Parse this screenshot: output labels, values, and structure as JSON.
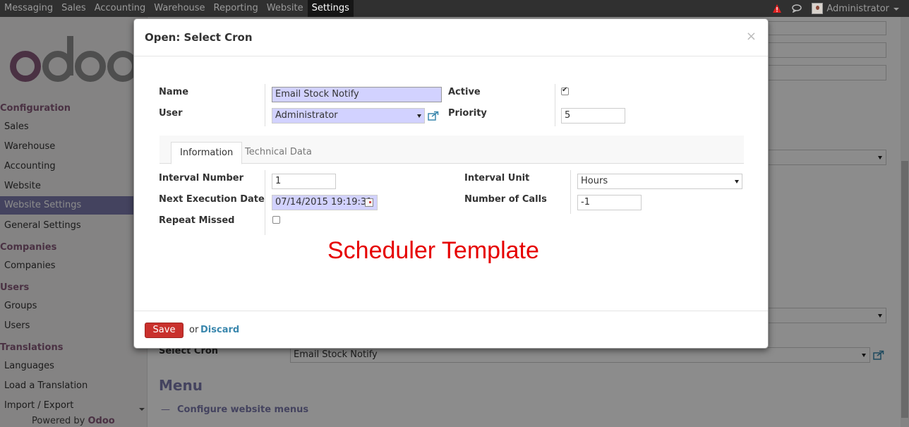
{
  "topbar": {
    "menu": [
      "Messaging",
      "Sales",
      "Accounting",
      "Warehouse",
      "Reporting",
      "Website",
      "Settings"
    ],
    "active": "Settings",
    "user": "Administrator"
  },
  "sidebar": {
    "sections": [
      {
        "title": "Configuration",
        "items": [
          "Sales",
          "Warehouse",
          "Accounting",
          "Website",
          "Website Settings",
          "General Settings"
        ]
      },
      {
        "title": "Companies",
        "items": [
          "Companies"
        ]
      },
      {
        "title": "Users",
        "items": [
          "Groups",
          "Users"
        ]
      },
      {
        "title": "Translations",
        "items": [
          "Languages",
          "Load a Translation",
          "Import / Export"
        ]
      }
    ],
    "active_item": "Website Settings",
    "powered_prefix": "Powered by",
    "powered_brand": "Odoo"
  },
  "background": {
    "select_cron_label": "Select Cron",
    "select_cron_value": "Email Stock Notify",
    "menu_heading": "Menu",
    "menu_link": "Configure website menus",
    "menu_dash": "—"
  },
  "modal": {
    "title": "Open: Select Cron",
    "close": "×",
    "name_label": "Name",
    "name_value": "Email Stock Notify",
    "user_label": "User",
    "user_value": "Administrator",
    "active_label": "Active",
    "active_checked": true,
    "priority_label": "Priority",
    "priority_value": "5",
    "tabs": [
      "Information",
      "Technical Data"
    ],
    "interval_number_label": "Interval Number",
    "interval_number_value": "1",
    "next_exec_label": "Next Execution Date",
    "next_exec_value": "07/14/2015 19:19:31",
    "repeat_missed_label": "Repeat Missed",
    "interval_unit_label": "Interval Unit",
    "interval_unit_value": "Hours",
    "number_calls_label": "Number of Calls",
    "number_calls_value": "-1",
    "annotation": "Scheduler Template",
    "save_label": "Save",
    "or_text": "or",
    "discard_label": "Discard"
  },
  "colors": {
    "accent": "#875a7b",
    "menu_purple": "#7c7bad",
    "save_red": "#c9302c",
    "annotation_red": "#e60000"
  }
}
